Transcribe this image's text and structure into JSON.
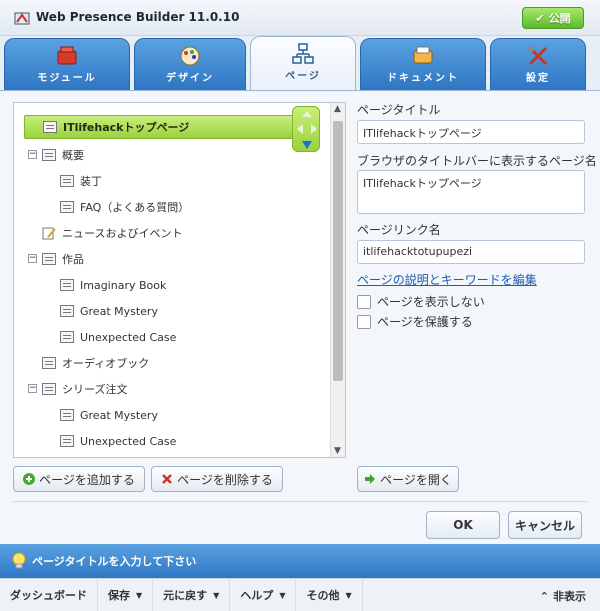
{
  "window": {
    "title": "Web Presence Builder 11.0.10",
    "publish_label": "公開"
  },
  "tabs": [
    {
      "label": "モジュール",
      "icon": "modules-icon",
      "active": false
    },
    {
      "label": "デザイン",
      "icon": "design-icon",
      "active": false
    },
    {
      "label": "ページ",
      "icon": "pages-icon",
      "active": true
    },
    {
      "label": "ドキュメント",
      "icon": "documents-icon",
      "active": false
    },
    {
      "label": "設定",
      "icon": "settings-icon",
      "active": false
    }
  ],
  "tree": [
    {
      "label": "ITlifehackトップページ",
      "level": 0,
      "selected": true
    },
    {
      "label": "概要",
      "level": 0,
      "expander": "−"
    },
    {
      "label": "装丁",
      "level": 1
    },
    {
      "label": "FAQ（よくある質問）",
      "level": 1
    },
    {
      "label": "ニュースおよびイベント",
      "level": 0,
      "icon": "news"
    },
    {
      "label": "作品",
      "level": 0,
      "expander": "−"
    },
    {
      "label": "Imaginary Book",
      "level": 1
    },
    {
      "label": "Great Mystery",
      "level": 1
    },
    {
      "label": "Unexpected Case",
      "level": 1
    },
    {
      "label": "オーディオブック",
      "level": 0
    },
    {
      "label": "シリーズ注文",
      "level": 0,
      "expander": "−"
    },
    {
      "label": "Great Mystery",
      "level": 1
    },
    {
      "label": "Unexpected Case",
      "level": 1
    }
  ],
  "form": {
    "page_title_label": "ページタイトル",
    "page_title_value": "ITlifehackトップページ",
    "browser_title_label": "ブラウザのタイトルバーに表示するページ名",
    "browser_title_value": "ITlifehackトップページ",
    "page_link_label": "ページリンク名",
    "page_link_value": "itlifehacktotupupezi",
    "edit_link": "ページの説明とキーワードを編集",
    "hide_page_label": "ページを表示しない",
    "protect_page_label": "ページを保護する"
  },
  "buttons": {
    "add_page": "ページを追加する",
    "delete_page": "ページを削除する",
    "open_page": "ページを開く",
    "ok": "OK",
    "cancel": "キャンセル"
  },
  "status": {
    "message": "ページタイトルを入力して下さい"
  },
  "bottom_bar": {
    "dashboard": "ダッシュボード",
    "save": "保存",
    "undo": "元に戻す",
    "help": "ヘルプ",
    "other": "その他",
    "hide": "非表示"
  },
  "colors": {
    "accent": "#2f76c4",
    "selection": "#9ad23f",
    "link": "#1f5db0"
  }
}
